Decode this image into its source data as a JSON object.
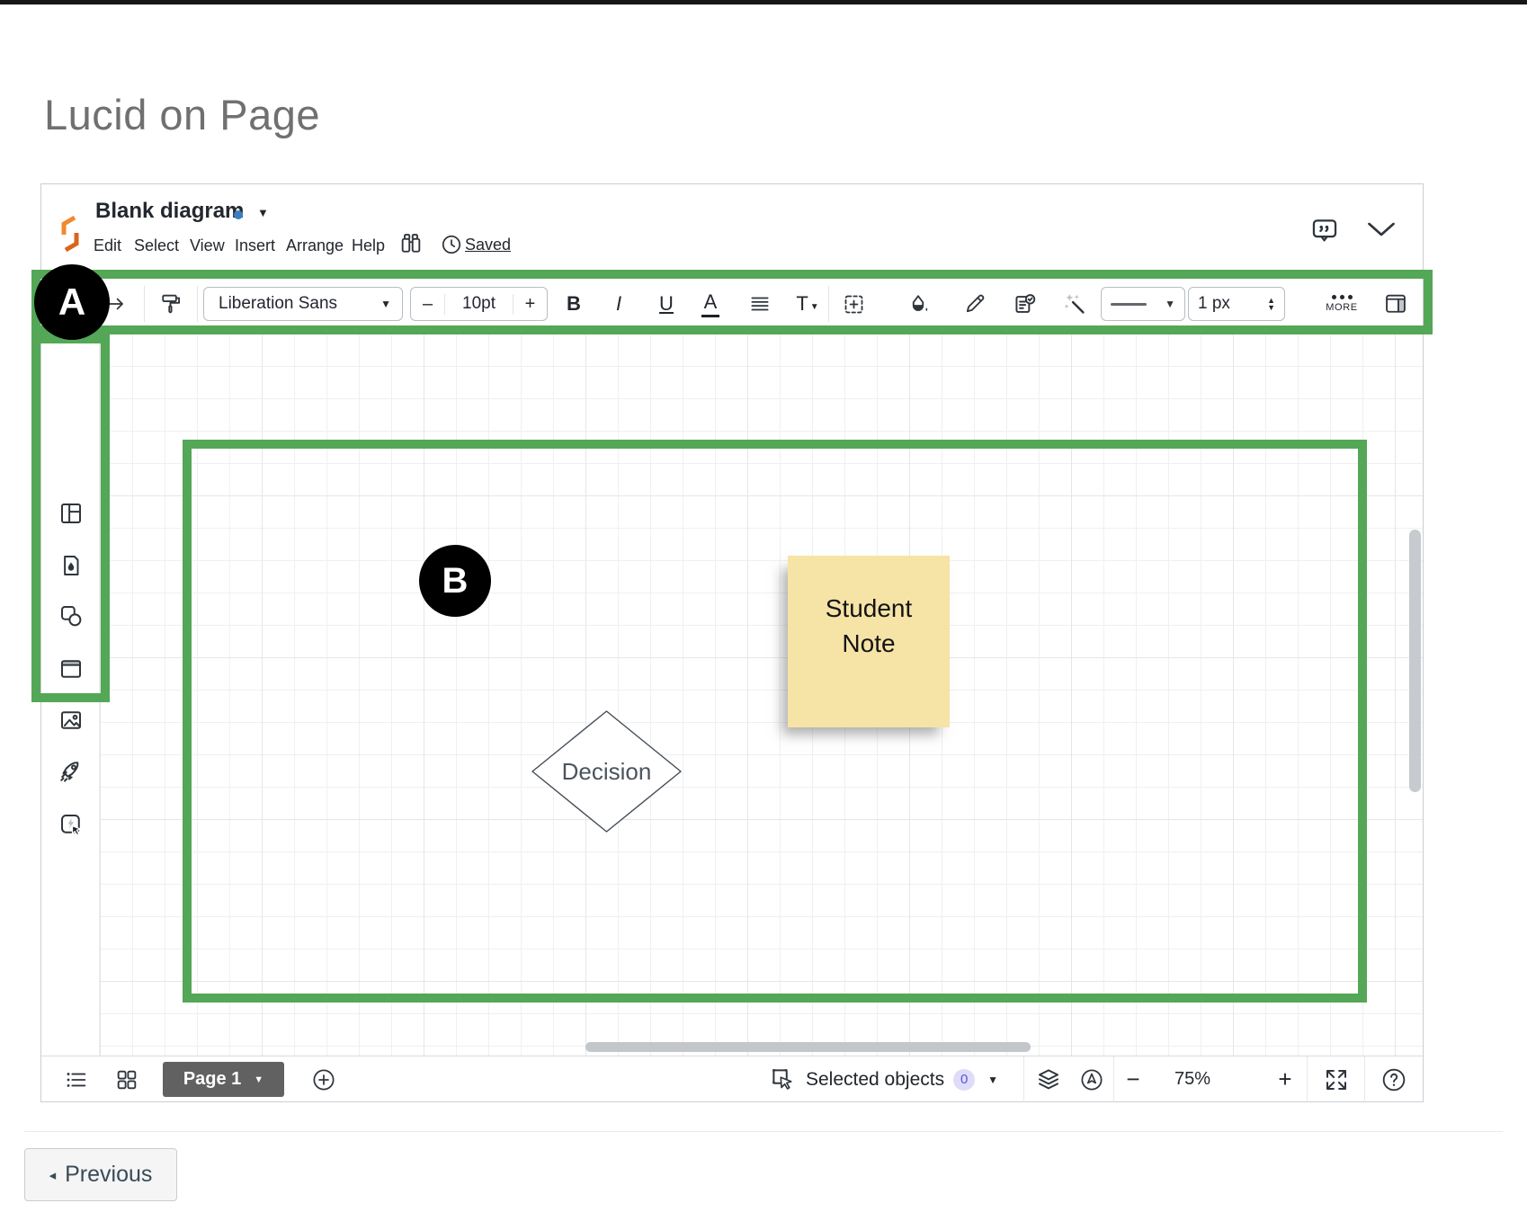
{
  "page": {
    "title": "Lucid on Page",
    "previous_label": "Previous",
    "previous_arrow": "◂"
  },
  "annotations": {
    "a": "A",
    "b": "B",
    "green": "#54a757"
  },
  "editor": {
    "header": {
      "doc_title": "Blank diagram",
      "menu": [
        "Edit",
        "Select",
        "View",
        "Insert",
        "Arrange",
        "Help"
      ],
      "saved_label": "Saved",
      "status_dot_color": "#3b7ec2"
    },
    "toolbar": {
      "font_family": "Liberation Sans",
      "font_size": "10pt",
      "size_minus": "–",
      "size_plus": "+",
      "bold": "B",
      "italic": "I",
      "underline": "U",
      "text_color": "A",
      "text_style": "T",
      "stroke_width": "1 px",
      "more_label": "MORE",
      "carets": {
        "down": "▼",
        "up": "▲"
      }
    },
    "canvas": {
      "sticky_note": {
        "line1": "Student",
        "line2": "Note",
        "fill": "#f6e3a6"
      },
      "decision": {
        "label": "Decision"
      }
    },
    "bottom_bar": {
      "page_label": "Page 1",
      "page_caret": "▼",
      "selected_objects_label": "Selected objects",
      "selected_count": "0",
      "zoom_out": "−",
      "zoom_level": "75%",
      "zoom_in": "+"
    }
  },
  "icons": {
    "lucid-logo": "orange isometric bracket",
    "title-caret": "▾",
    "binoculars-icon": "find",
    "clock-icon": "autosave clock",
    "comment-icon": "speech bubble with quotes",
    "chevron-down-icon": "⌄",
    "redo-icon": "→",
    "format-painter-icon": "paint roller",
    "align-icon": "≣",
    "snap-area-icon": "⊞",
    "fill-color-icon": "ink bottle",
    "line-color-icon": "✎",
    "conditional-format-icon": "checklist",
    "magic-wand-icon": "wand with sparkles",
    "line-style-icon": "—",
    "more-icon": "•••",
    "panel-toggle-icon": "split panel",
    "dock-layout-icon": "template layout",
    "dock-theme-icon": "document with ink drop",
    "dock-shapes-icon": "square and circle",
    "dock-container-icon": "window frame",
    "dock-image-icon": "picture",
    "dock-rocket-icon": "rocket",
    "dock-quick-action-icon": "lightning with cursor",
    "pages-list-icon": "bulleted list",
    "pages-grid-icon": "four squares",
    "add-page-icon": "⊕",
    "select-tool-icon": "selection cursor",
    "layers-icon": "stacked layers",
    "locate-icon": "circled arrow",
    "fullscreen-icon": "expand arrows",
    "help-icon": "?"
  }
}
